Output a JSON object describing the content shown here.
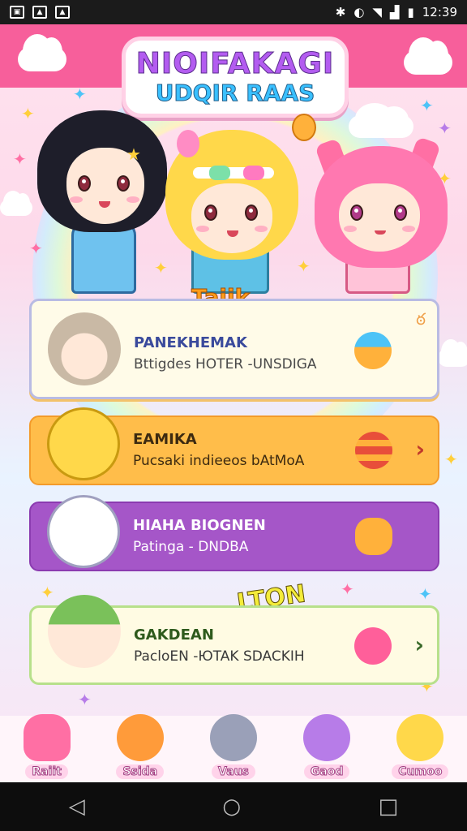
{
  "status_bar": {
    "left_icons": [
      "image-icon",
      "image-icon",
      "image-icon"
    ],
    "right_icons": [
      "vibrate-icon",
      "sync-icon",
      "wifi-icon",
      "signal-icon",
      "battery-icon"
    ],
    "time": "12:39"
  },
  "header": {
    "title_line1": "NIOIFAKAGI",
    "title_line2": "UDQIR RAAS"
  },
  "section_tag": "Taijk",
  "cards": [
    {
      "title": "PANEKHEMAK",
      "subtitle": "Bttigdes HOTER -UNSDIGA",
      "icon": "egg-icon",
      "bg": "#fffbe8"
    },
    {
      "title": "EAMIKA",
      "subtitle": "Pucsaki indieeos bAtMoA",
      "icon": "fruit-icon",
      "bg": "#ffbd4a"
    },
    {
      "title": "HIAHA BIOGNEN",
      "subtitle": "Patinga - DNDBA",
      "icon": "bear-icon",
      "bg": "#a556c8"
    },
    {
      "title": "GAKDEAN",
      "subtitle": "PacloEN -ЮTAK SDACKIH",
      "icon": "berry-icon",
      "bg": "#fffbe3"
    }
  ],
  "sticker_text": "LTON",
  "tabs": [
    {
      "label": "Raiit",
      "icon": "jelly-icon"
    },
    {
      "label": "Ssida",
      "icon": "fox-icon"
    },
    {
      "label": "Vaus",
      "icon": "cat-icon"
    },
    {
      "label": "Gaod",
      "icon": "purple-cat-icon"
    },
    {
      "label": "Cumoo",
      "icon": "yellow-cat-icon"
    }
  ],
  "nav": {
    "back": "◁",
    "home": "○",
    "recents": "□"
  },
  "colors": {
    "brand_pink": "#f75f9b",
    "accent_orange": "#ffbd4a",
    "accent_purple": "#a556c8"
  }
}
